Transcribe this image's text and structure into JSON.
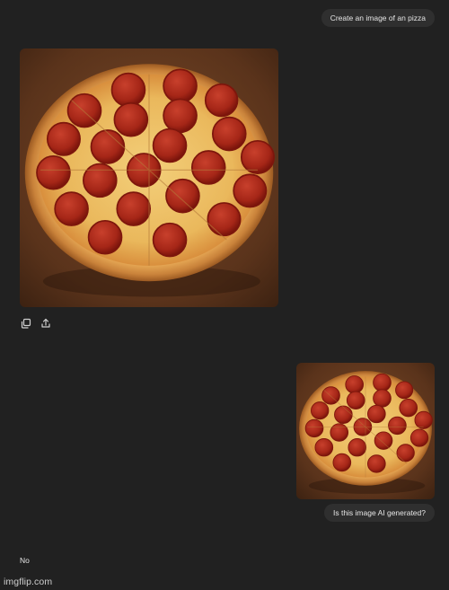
{
  "conversation": {
    "user_message_1": "Create an image of an pizza",
    "user_message_2": "Is this image AI generated?",
    "assistant_reply": "No"
  },
  "generated_image": {
    "subject": "pepperoni pizza on a wooden board"
  },
  "actions": {
    "copy_icon": "copy-icon",
    "share_icon": "share-icon"
  },
  "watermark": "imgflip.com",
  "colors": {
    "background": "#212121",
    "bubble": "#2f2f2f",
    "text": "#e6e6e6"
  }
}
